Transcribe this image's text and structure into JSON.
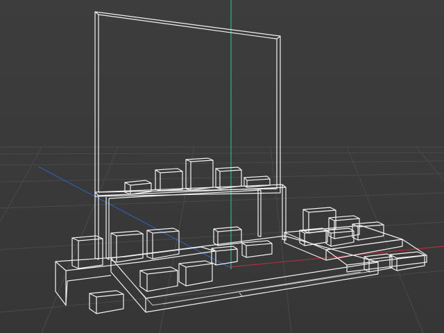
{
  "viewport": {
    "background_color": "#3a3a3a",
    "grid_color": "#4a4a4a",
    "wireframe_color": "#f2f2f2",
    "axis_colors": {
      "x": "#b5303a",
      "y": "#2db38a",
      "z": "#2d5fb3"
    }
  },
  "scene": {
    "objects": [
      "backdrop-panel",
      "upper-shelf",
      "base-platform",
      "left-step-platform",
      "right-step-platform",
      "boxes"
    ]
  }
}
